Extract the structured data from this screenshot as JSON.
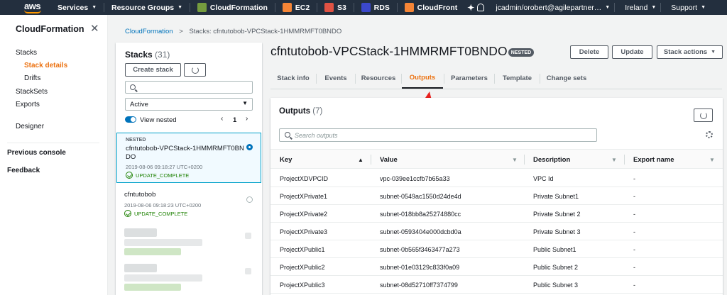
{
  "nav": {
    "logo": "aws",
    "services": "Services",
    "resource_groups": "Resource Groups",
    "services_list": [
      {
        "label": "CloudFormation",
        "icon": "cloudformation-icon",
        "color": "#759c3e"
      },
      {
        "label": "EC2",
        "icon": "ec2-icon",
        "color": "#f58536"
      },
      {
        "label": "S3",
        "icon": "s3-icon",
        "color": "#e05243"
      },
      {
        "label": "RDS",
        "icon": "rds-icon",
        "color": "#3b48cc"
      },
      {
        "label": "CloudFront",
        "icon": "cloudfront-icon",
        "color": "#f58536"
      }
    ],
    "user": "jcadmin/orobert@agilepartner…",
    "region": "Ireland",
    "support": "Support"
  },
  "sidebar": {
    "title": "CloudFormation",
    "items": [
      "Stacks",
      "Stack details",
      "Drifts",
      "StackSets",
      "Exports",
      "Designer",
      "Previous console",
      "Feedback"
    ]
  },
  "breadcrumb": {
    "root": "CloudFormation",
    "current": "Stacks: cfntutobob-VPCStack-1HMMRMFT0BNDO"
  },
  "stacks": {
    "title": "Stacks",
    "count": "(31)",
    "create_label": "Create stack",
    "filter_value": "Active",
    "view_nested_label": "View nested",
    "page": "1",
    "items": [
      {
        "nested": "NESTED",
        "name": "cfntutobob-VPCStack-1HMMRMFT0BNDO",
        "date": "2019-08-06 09:18:27 UTC+0200",
        "status": "UPDATE_COMPLETE"
      },
      {
        "nested": "",
        "name": "cfntutobob",
        "date": "2019-08-06 09:18:23 UTC+0200",
        "status": "UPDATE_COMPLETE"
      }
    ]
  },
  "detail": {
    "title": "cfntutobob-VPCStack-1HMMRMFT0BNDO",
    "badge": "NESTED",
    "buttons": [
      "Delete",
      "Update",
      "Stack actions"
    ],
    "tabs": [
      "Stack info",
      "Events",
      "Resources",
      "Outputs",
      "Parameters",
      "Template",
      "Change sets"
    ]
  },
  "outputs": {
    "title": "Outputs",
    "count": "(7)",
    "search_placeholder": "Search outputs",
    "columns": [
      "Key",
      "Value",
      "Description",
      "Export name"
    ],
    "rows": [
      [
        "ProjectXDVPCID",
        "vpc-039ee1ccfb7b65a33",
        "VPC Id",
        "-"
      ],
      [
        "ProjectXPrivate1",
        "subnet-0549ac1550d24de4d",
        "Private Subnet1",
        "-"
      ],
      [
        "ProjectXPrivate2",
        "subnet-018bb8a25274880cc",
        "Private Subnet 2",
        "-"
      ],
      [
        "ProjectXPrivate3",
        "subnet-0593404e000dcbd0a",
        "Private Subnet 3",
        "-"
      ],
      [
        "ProjectXPublic1",
        "subnet-0b565f3463477a273",
        "Public Subnet1",
        "-"
      ],
      [
        "ProjectXPublic2",
        "subnet-01e03129c833f0a09",
        "Public Subnet 2",
        "-"
      ],
      [
        "ProjectXPublic3",
        "subnet-08d52710ff7374799",
        "Public Subnet 3",
        "-"
      ]
    ]
  },
  "colors": {
    "nav_bg": "#232f3e",
    "accent": "#ec7211",
    "link": "#0073bb",
    "success": "#1d8102",
    "annotation_arrow": "#e8211e"
  }
}
